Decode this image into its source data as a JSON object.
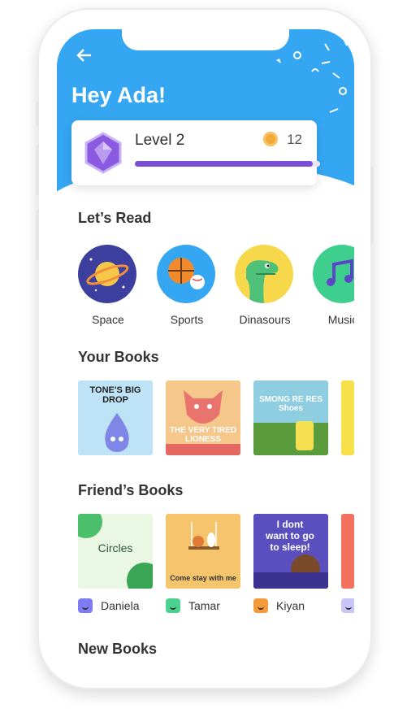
{
  "header": {
    "back_icon": "arrow-left-icon",
    "greeting": "Hey Ada!"
  },
  "level": {
    "label": "Level 2",
    "coins": "12",
    "progress_fraction": 0.96,
    "badge_icon": "gem-badge-icon"
  },
  "sections": {
    "lets_read": "Let’s Read",
    "your_books": "Your Books",
    "friends_books": "Friend’s Books",
    "new_books": "New Books"
  },
  "categories": [
    {
      "label": "Space",
      "color": "#3d3f9e"
    },
    {
      "label": "Sports",
      "color": "#35a6f2"
    },
    {
      "label": "Dinasours",
      "color": "#f6d84a"
    },
    {
      "label": "Music",
      "color": "#3ecf8e"
    }
  ],
  "your_books": [
    {
      "title": "TONE'S BIG DROP"
    },
    {
      "title": "THE VERY TIRED LIONESS"
    },
    {
      "title": "SMONG RE RES Shoes"
    }
  ],
  "friends_books": [
    {
      "title": "Circles",
      "reader": "Daniela"
    },
    {
      "title": "Come stay with me",
      "reader": "Tamar"
    },
    {
      "title": "I dont want to go to sleep!",
      "reader": "Kiyan"
    }
  ],
  "colors": {
    "primary": "#35a6f2",
    "progress": "#7a4fd6"
  }
}
